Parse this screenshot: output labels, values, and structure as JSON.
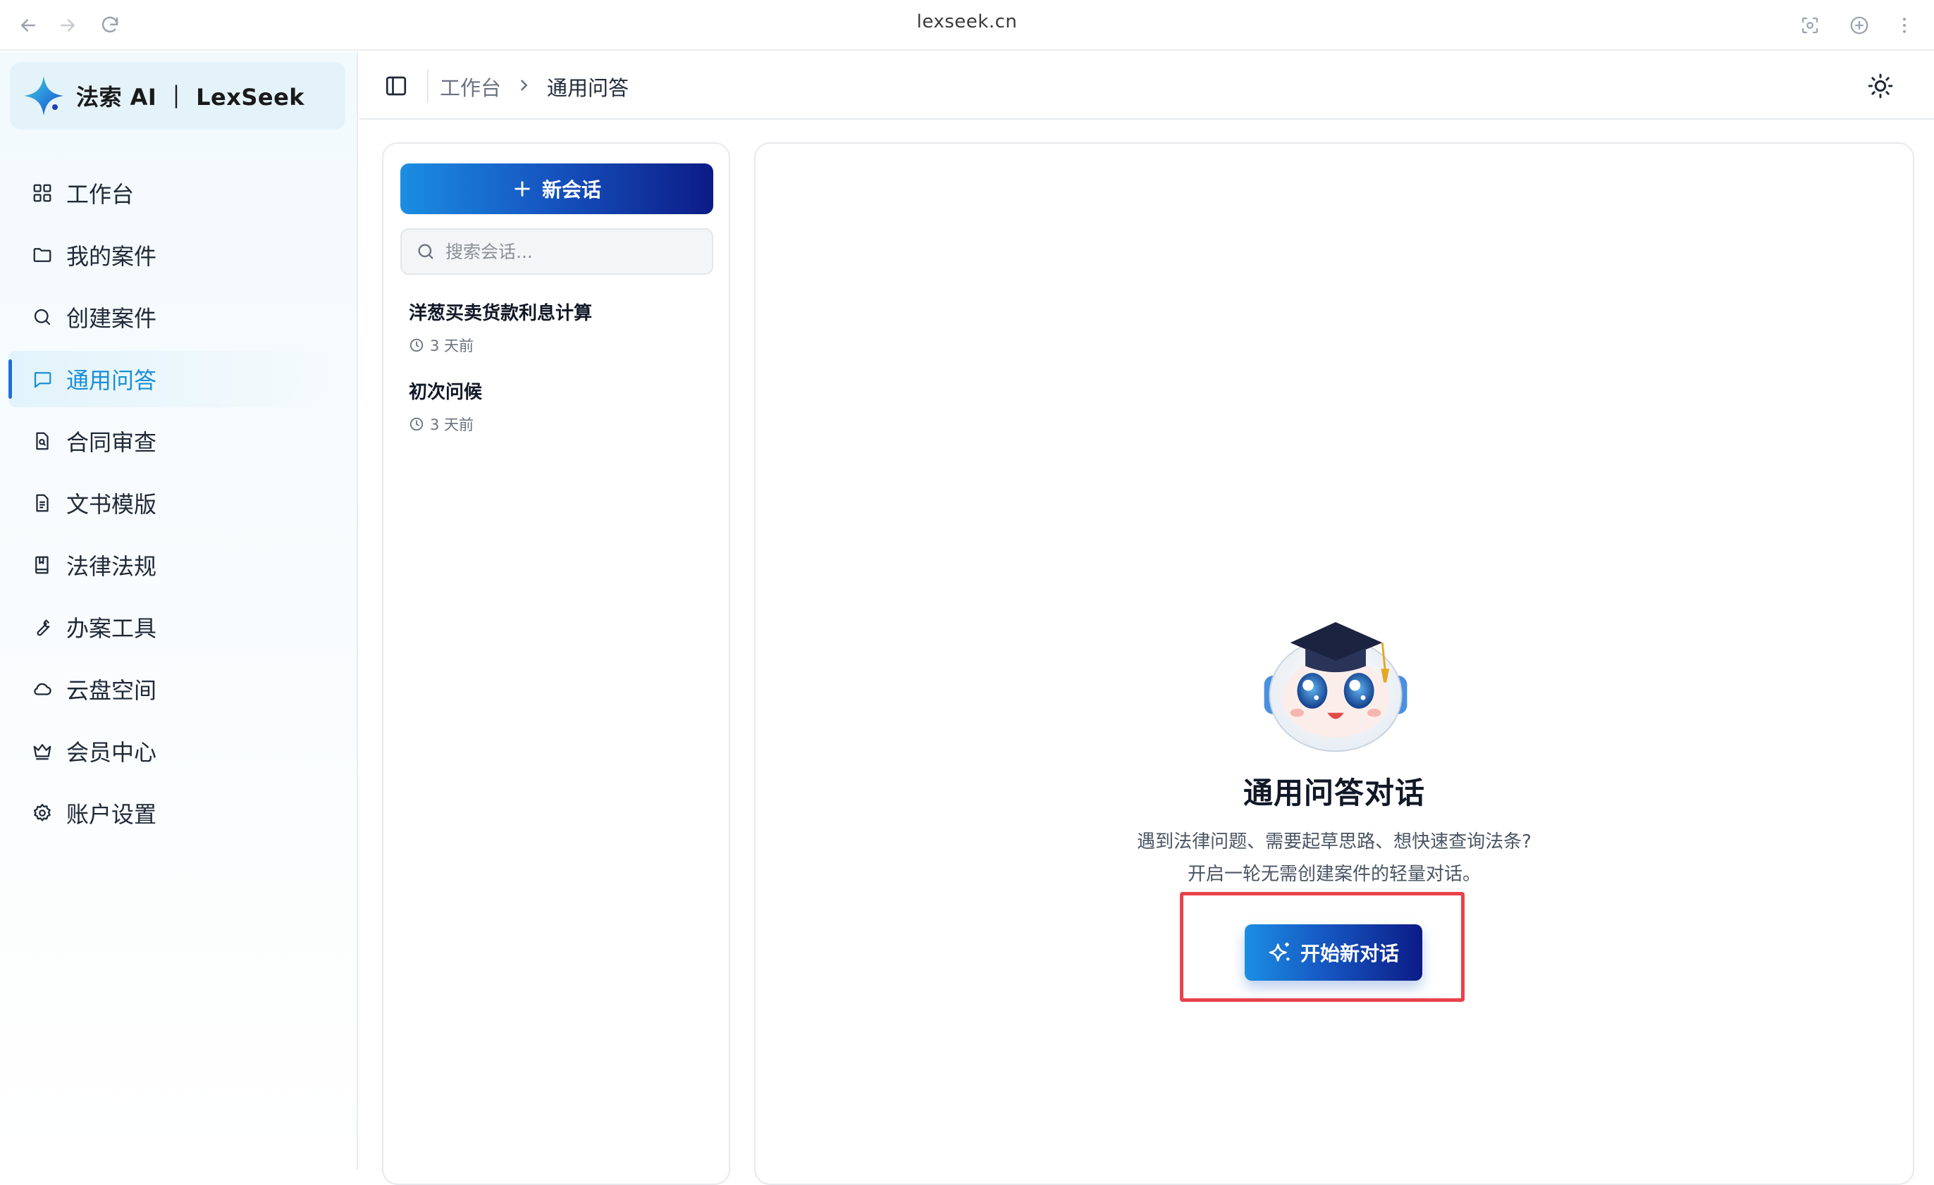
{
  "browser": {
    "url": "lexseek.cn"
  },
  "brand": {
    "name": "法索 AI ｜ LexSeek"
  },
  "sidebar": {
    "items": [
      {
        "label": "工作台",
        "icon": "grid-icon"
      },
      {
        "label": "我的案件",
        "icon": "folder-icon"
      },
      {
        "label": "创建案件",
        "icon": "search-icon"
      },
      {
        "label": "通用问答",
        "icon": "chat-icon",
        "active": true
      },
      {
        "label": "合同审查",
        "icon": "file-search-icon"
      },
      {
        "label": "文书模版",
        "icon": "document-icon"
      },
      {
        "label": "法律法规",
        "icon": "book-icon"
      },
      {
        "label": "办案工具",
        "icon": "wrench-icon"
      },
      {
        "label": "云盘空间",
        "icon": "cloud-icon"
      },
      {
        "label": "会员中心",
        "icon": "crown-icon"
      },
      {
        "label": "账户设置",
        "icon": "gear-icon"
      }
    ]
  },
  "breadcrumb": {
    "parent": "工作台",
    "current": "通用问答"
  },
  "conversations": {
    "new_label": "新会话",
    "search_placeholder": "搜索会话...",
    "items": [
      {
        "title": "洋葱买卖货款利息计算",
        "time": "3 天前"
      },
      {
        "title": "初次问候",
        "time": "3 天前"
      }
    ]
  },
  "empty_state": {
    "title": "通用问答对话",
    "desc_line1": "遇到法律问题、需要起草思路、想快速查询法条?",
    "desc_line2": "开启一轮无需创建案件的轻量对话。",
    "button_label": "开始新对话"
  },
  "colors": {
    "accent": "#1657c2",
    "active_text": "#1a8fd6",
    "highlight": "#e8424b"
  }
}
